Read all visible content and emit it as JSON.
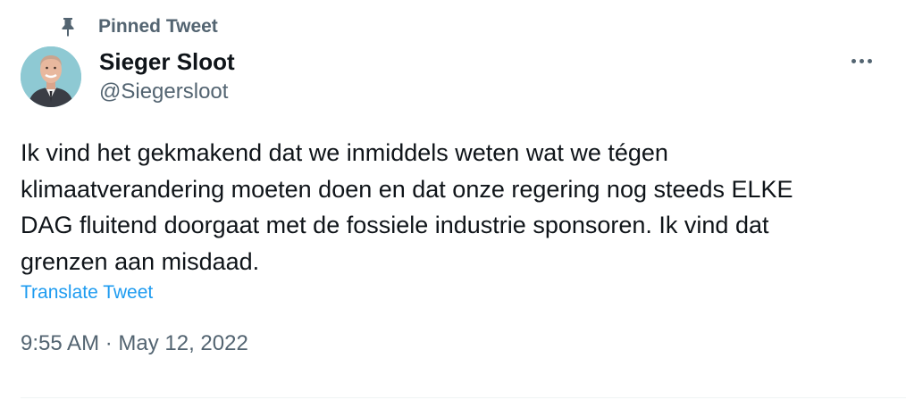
{
  "pinned": {
    "label": "Pinned Tweet",
    "icon": "pin-icon"
  },
  "author": {
    "display_name": "Sieger Sloot",
    "handle": "@Siegersloot",
    "avatar_icon": "avatar"
  },
  "menu": {
    "icon": "more-icon"
  },
  "tweet": {
    "text": "Ik vind het gekmakend dat we inmiddels weten wat we tégen\nklimaatverandering moeten doen en dat onze regering nog steeds ELKE\nDAG fluitend doorgaat met de fossiele industrie sponsoren. Ik vind dat\ngrenzen aan misdaad.",
    "translate_label": "Translate Tweet",
    "timestamp": "9:55 AM · May 12, 2022"
  },
  "colors": {
    "text_primary": "#0f1419",
    "text_secondary": "#536471",
    "link": "#1d9bf0",
    "divider": "#eff3f4"
  }
}
